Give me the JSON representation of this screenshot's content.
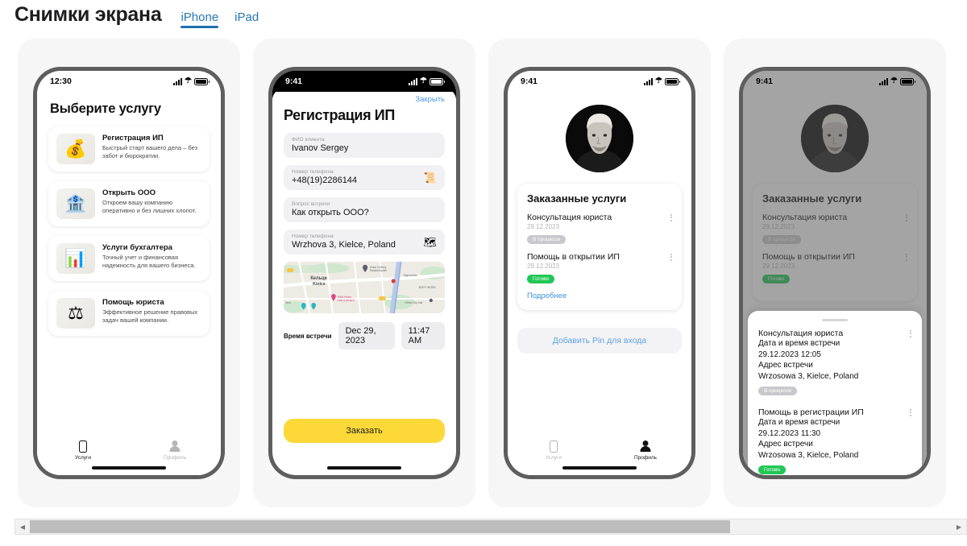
{
  "header": {
    "title": "Снимки экрана",
    "tabs": [
      {
        "label": "iPhone",
        "active": true
      },
      {
        "label": "iPad",
        "active": false
      }
    ]
  },
  "colors": {
    "accent_yellow": "#fcd839",
    "link_blue": "#3b8fe0",
    "badge_done_green": "#21c755",
    "badge_progress_gray": "#c9c9cd",
    "tab_underline": "#1f6fb2"
  },
  "screens": [
    {
      "id": "services",
      "statusbar": {
        "time": "12:30",
        "theme": "light"
      },
      "title": "Выберите услугу",
      "services": [
        {
          "name": "Регистрация ИП",
          "desc": "Быстрый старт вашего дела – без забот и бюрократии.",
          "icon": "gold-bars-icon"
        },
        {
          "name": "Открыть ООО",
          "desc": "Откроем вашу компанию оперативно и без лишних хлопот.",
          "icon": "gold-building-icon"
        },
        {
          "name": "Услуги бухгалтера",
          "desc": "Точный учет и финансовая надежность для вашего бизнеса.",
          "icon": "gold-chart-icon"
        },
        {
          "name": "Помощь юриста",
          "desc": "Эффективное решение правовых задач вашей компании.",
          "icon": "gold-scales-icon"
        }
      ],
      "tabbar": [
        {
          "label": "Услуги",
          "active": true
        },
        {
          "label": "Профиль",
          "active": false
        }
      ]
    },
    {
      "id": "registration",
      "statusbar": {
        "time": "9:41",
        "theme": "dark"
      },
      "close_label": "Закрыть",
      "title": "Регистрация ИП",
      "fields": [
        {
          "label": "ФИО клиента",
          "value": "Ivanov Sergey",
          "icon": ""
        },
        {
          "label": "Номер телефона",
          "value": "+48(19)2286144",
          "icon": "contacts-icon"
        },
        {
          "label": "Вопрос встречи",
          "value": "Как открыть ООО?",
          "icon": ""
        },
        {
          "label": "Номер телефона",
          "value": "Wrzhova 3, Kielce, Poland",
          "icon": "map-icon"
        }
      ],
      "map": {
        "city_ru": "Кельце",
        "city_en": "Kielce",
        "poi": [
          "Oskar Kolberg Świętokrzyskie",
          "Zagnańska",
          "BODY WORK",
          "Willa Hueta hotel & pensjon",
          "Kielce City Hall"
        ]
      },
      "time_row": {
        "label": "Время встречи",
        "date": "Dec 29, 2023",
        "time": "11:47 AM"
      },
      "submit_label": "Заказать"
    },
    {
      "id": "profile",
      "statusbar": {
        "time": "9:41",
        "theme": "light"
      },
      "avatar_alt": "user-avatar",
      "orders_title": "Заказанные услуги",
      "orders": [
        {
          "name": "Консультация юриста",
          "date": "29.12.2023",
          "status": "В процессе",
          "status_kind": "progress"
        },
        {
          "name": "Помощь в открытии ИП",
          "date": "29.12.2023",
          "status": "Готово",
          "status_kind": "done"
        }
      ],
      "more_label": "Подробнее",
      "pin_label": "Добавить Pin для входа",
      "tabbar": [
        {
          "label": "Услуги",
          "active": false
        },
        {
          "label": "Профиль",
          "active": true
        }
      ]
    },
    {
      "id": "order-details",
      "statusbar": {
        "time": "9:41",
        "theme": "light"
      },
      "orders_title": "Заказанные услуги",
      "orders": [
        {
          "name": "Консультация юриста",
          "date": "29.12.2023",
          "status": "В процессе",
          "status_kind": "progress"
        },
        {
          "name": "Помощь в открытии ИП",
          "date": "29.12.2023",
          "status": "Готово",
          "status_kind": "done"
        }
      ],
      "details": [
        {
          "name": "Консультация юриста",
          "datetime_label": "Дата и время встречи",
          "datetime_value": "29.12.2023 12:05",
          "address_label": "Адрес встречи",
          "address_value": "Wrzosowa 3, Kielce, Poland",
          "status": "В процессе",
          "status_kind": "progress"
        },
        {
          "name": "Помощь в регистрации ИП",
          "datetime_label": "Дата и время встречи",
          "datetime_value": "29.12.2023 11:30",
          "address_label": "Адрес встречи",
          "address_value": "Wrzosowa 3, Kielce, Poland",
          "status": "Готово",
          "status_kind": "done"
        }
      ]
    }
  ],
  "scrollbar": {
    "left_arrow": "◀",
    "right_arrow": "▶"
  }
}
